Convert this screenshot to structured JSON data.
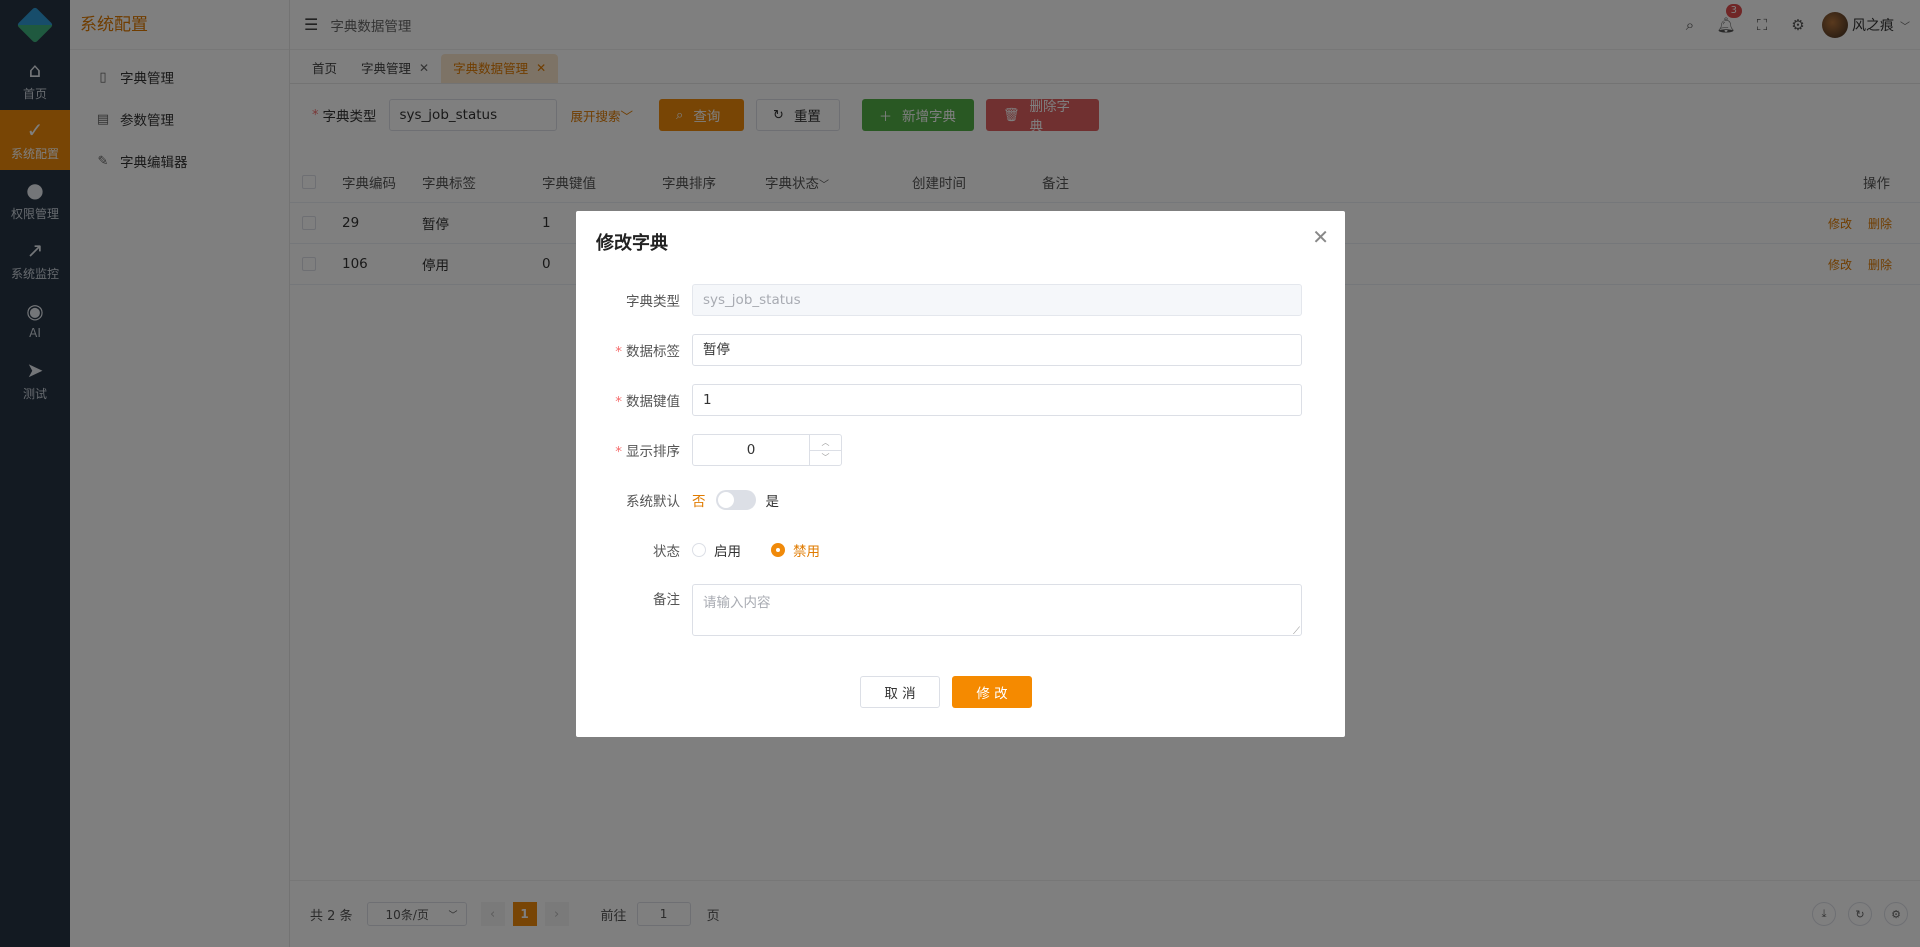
{
  "rail": {
    "items": [
      {
        "label": "首页",
        "icon": "home-icon",
        "glyph": "⌂"
      },
      {
        "label": "系统配置",
        "icon": "clipboard-check-icon",
        "glyph": "✓"
      },
      {
        "label": "权限管理",
        "icon": "user-icon",
        "glyph": "●"
      },
      {
        "label": "系统监控",
        "icon": "line-chart-icon",
        "glyph": "↗"
      },
      {
        "label": "AI",
        "icon": "chrome-icon",
        "glyph": "◉"
      },
      {
        "label": "测试",
        "icon": "paper-plane-icon",
        "glyph": "➤"
      }
    ],
    "active_index": 1
  },
  "submenu": {
    "title": "系统配置",
    "items": [
      {
        "label": "字典管理",
        "icon": "book-icon",
        "glyph": "▯"
      },
      {
        "label": "参数管理",
        "icon": "document-icon",
        "glyph": "▤"
      },
      {
        "label": "字典编辑器",
        "icon": "edit-icon",
        "glyph": "✎"
      }
    ]
  },
  "topbar": {
    "breadcrumb": "字典数据管理",
    "notification_count": "3",
    "username": "风之痕"
  },
  "tabs": [
    {
      "label": "首页",
      "closable": false
    },
    {
      "label": "字典管理",
      "closable": true
    },
    {
      "label": "字典数据管理",
      "closable": true
    }
  ],
  "search": {
    "label": "字典类型",
    "value": "sys_job_status",
    "expand_label": "展开搜索",
    "query_label": "查询",
    "reset_label": "重置",
    "add_label": "新增字典",
    "delete_label": "删除字典"
  },
  "table": {
    "headers": {
      "code": "字典编码",
      "label": "字典标签",
      "value": "字典键值",
      "sort": "字典排序",
      "status": "字典状态",
      "created": "创建时间",
      "remark": "备注",
      "actions": "操作"
    },
    "rows": [
      {
        "code": "29",
        "label": "暂停",
        "value": "1"
      },
      {
        "code": "106",
        "label": "停用",
        "value": "0"
      }
    ],
    "edit_label": "修改",
    "delete_label": "删除"
  },
  "pager": {
    "total": "共 2 条",
    "page_size": "10条/页",
    "current_page": "1",
    "goto_label": "前往",
    "goto_value": "1",
    "page_suffix": "页"
  },
  "dialog": {
    "title": "修改字典",
    "fields": {
      "type_label": "字典类型",
      "type_value": "sys_job_status",
      "tag_label": "数据标签",
      "tag_value": "暂停",
      "key_label": "数据键值",
      "key_value": "1",
      "sort_label": "显示排序",
      "sort_value": "0",
      "default_label": "系统默认",
      "default_off": "否",
      "default_on": "是",
      "default_checked": false,
      "status_label": "状态",
      "status_enable": "启用",
      "status_disable": "禁用",
      "status_selected": "禁用",
      "remark_label": "备注",
      "remark_placeholder": "请输入内容"
    },
    "cancel_label": "取 消",
    "ok_label": "修 改"
  },
  "colors": {
    "accent": "#f08a0a",
    "sidebar_bg": "#263445",
    "success": "#52b046",
    "danger": "#e06060"
  }
}
